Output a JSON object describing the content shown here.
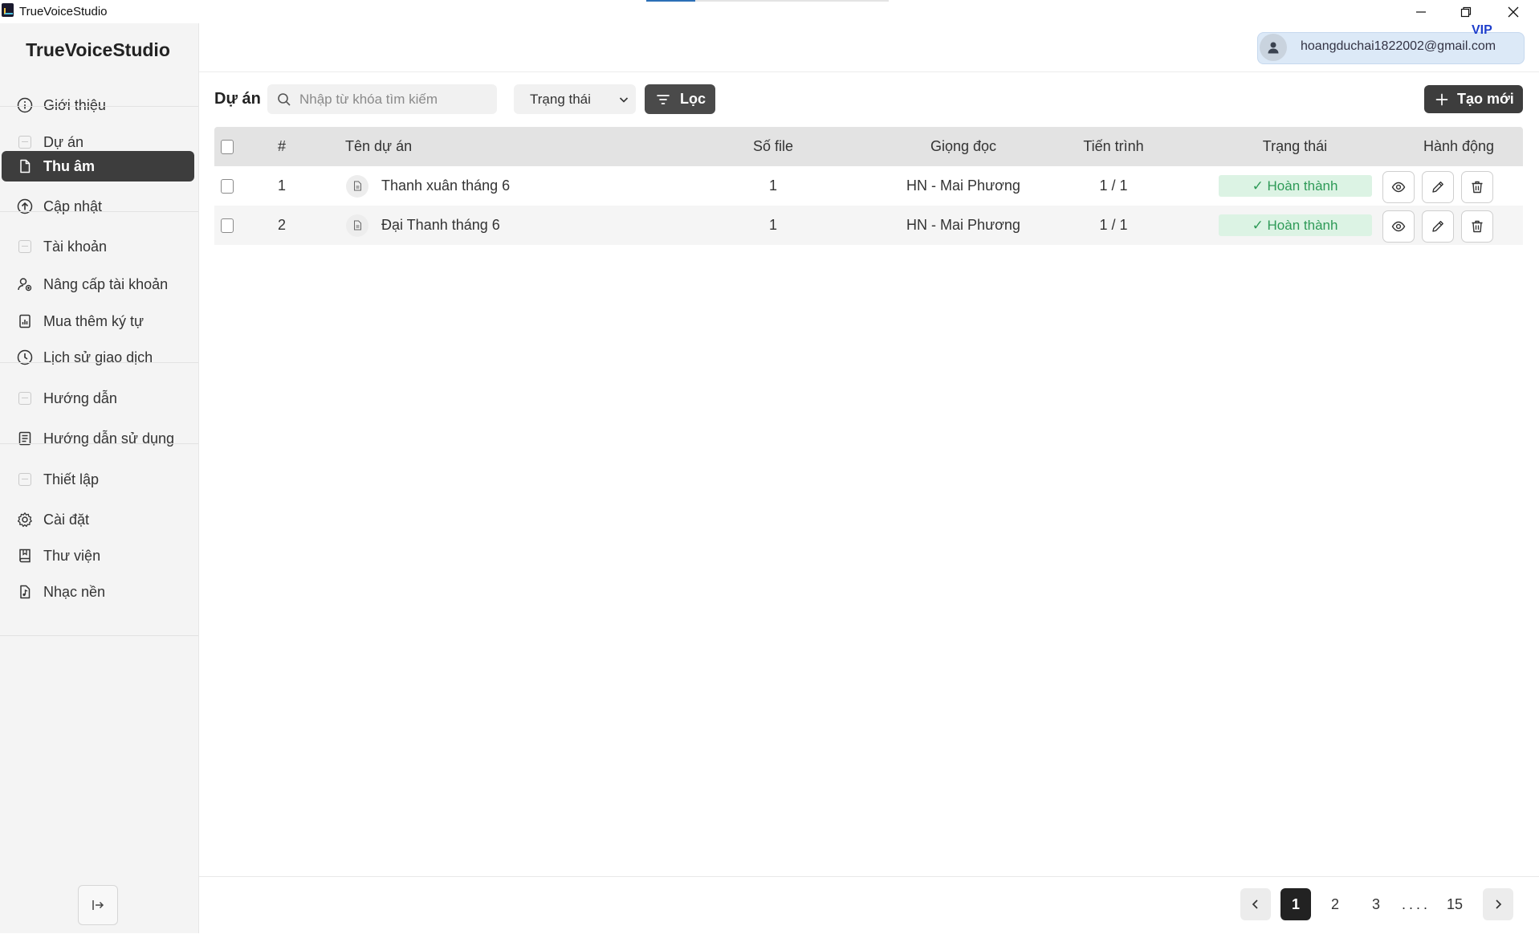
{
  "window": {
    "title": "TrueVoiceStudio"
  },
  "sidebar": {
    "brand": "TrueVoiceStudio",
    "items": [
      {
        "label": "Giới thiệu",
        "icon": "info-icon"
      },
      {
        "label": "Dự án",
        "icon": "placeholder-icon"
      },
      {
        "label": "Thu âm",
        "icon": "file-icon",
        "active": true
      },
      {
        "label": "Cập nhật",
        "icon": "upload-circle-icon"
      },
      {
        "label": "Tài khoản",
        "icon": "placeholder-icon"
      },
      {
        "label": "Nâng cấp tài khoản",
        "icon": "user-upgrade-icon"
      },
      {
        "label": "Mua thêm ký tự",
        "icon": "receipt-icon"
      },
      {
        "label": "Lịch sử giao dịch",
        "icon": "clock-icon"
      },
      {
        "label": "Hướng dẫn",
        "icon": "placeholder-icon"
      },
      {
        "label": "Hướng dẫn sử dụng",
        "icon": "document-list-icon"
      },
      {
        "label": "Thiết lập",
        "icon": "placeholder-icon"
      },
      {
        "label": "Cài đặt",
        "icon": "gear-icon"
      },
      {
        "label": "Thư viện",
        "icon": "book-icon"
      },
      {
        "label": "Nhạc nền",
        "icon": "music-file-icon"
      }
    ]
  },
  "header": {
    "email": "hoangduchai1822002@gmail.com",
    "badge": "VIP"
  },
  "toolbar": {
    "title": "Dự án",
    "search_placeholder": "Nhập từ khóa tìm kiếm",
    "status_select": "Trạng thái",
    "filter_label": "Lọc",
    "create_label": "Tạo mới"
  },
  "table": {
    "headers": {
      "index": "#",
      "name": "Tên dự án",
      "files": "Số file",
      "voice": "Giọng đọc",
      "progress": "Tiến trình",
      "status": "Trạng thái",
      "actions": "Hành động"
    },
    "rows": [
      {
        "index": "1",
        "name": "Thanh xuân tháng 6",
        "files": "1",
        "voice": "HN - Mai Phương",
        "progress": "1 / 1",
        "status": "✓ Hoàn thành"
      },
      {
        "index": "2",
        "name": "Đại Thanh tháng 6",
        "files": "1",
        "voice": "HN - Mai Phương",
        "progress": "1 / 1",
        "status": "✓ Hoàn thành"
      }
    ]
  },
  "pagination": {
    "pages": [
      "1",
      "2",
      "3"
    ],
    "ellipsis": "....",
    "last": "15",
    "current": "1"
  },
  "colors": {
    "sidebar_active": "#3d3d3d",
    "status_bg": "#dcf3e4",
    "status_text": "#2e9a57",
    "vip": "#1e3fcc",
    "user_chip": "#dce9f7"
  }
}
